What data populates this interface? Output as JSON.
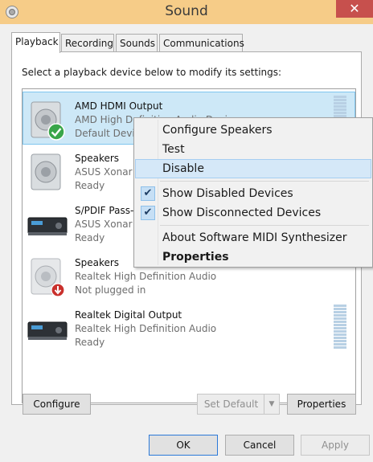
{
  "window": {
    "title": "Sound",
    "close_glyph": "✕"
  },
  "tabs": [
    {
      "label": "Playback",
      "active": true
    },
    {
      "label": "Recording"
    },
    {
      "label": "Sounds"
    },
    {
      "label": "Communications"
    }
  ],
  "instructions": "Select a playback device below to modify its settings:",
  "devices": [
    {
      "name": "AMD HDMI Output",
      "description": "AMD High Definition Audio Device",
      "status": "Default Device",
      "icon": "speaker-icon",
      "selected": true,
      "badge": "default-check-icon"
    },
    {
      "name": "Speakers",
      "description": "ASUS Xonar DG Audio Device",
      "status": "Ready",
      "icon": "speaker-icon"
    },
    {
      "name": "S/PDIF Pass-through Device",
      "description": "ASUS Xonar DG Audio Device",
      "status": "Ready",
      "icon": "digital-output-icon"
    },
    {
      "name": "Speakers",
      "description": "Realtek High Definition Audio",
      "status": "Not plugged in",
      "icon": "speaker-icon",
      "badge": "unplugged-icon"
    },
    {
      "name": "Realtek Digital Output",
      "description": "Realtek High Definition Audio",
      "status": "Ready",
      "icon": "digital-output-icon"
    }
  ],
  "context_menu": {
    "items": [
      {
        "label": "Configure Speakers"
      },
      {
        "label": "Test"
      },
      {
        "label": "Disable",
        "highlighted": true
      },
      {
        "label": "Show Disabled Devices",
        "checked": true
      },
      {
        "label": "Show Disconnected Devices",
        "checked": true
      },
      {
        "label": "About Software MIDI Synthesizer"
      },
      {
        "label": "Properties",
        "bold": true
      }
    ]
  },
  "buttons": {
    "configure": "Configure",
    "set_default": "Set Default",
    "properties": "Properties",
    "ok": "OK",
    "cancel": "Cancel",
    "apply": "Apply"
  },
  "colors": {
    "titlebar": "#f6cc88",
    "selection": "#cde8f7",
    "close": "#c7504d"
  }
}
